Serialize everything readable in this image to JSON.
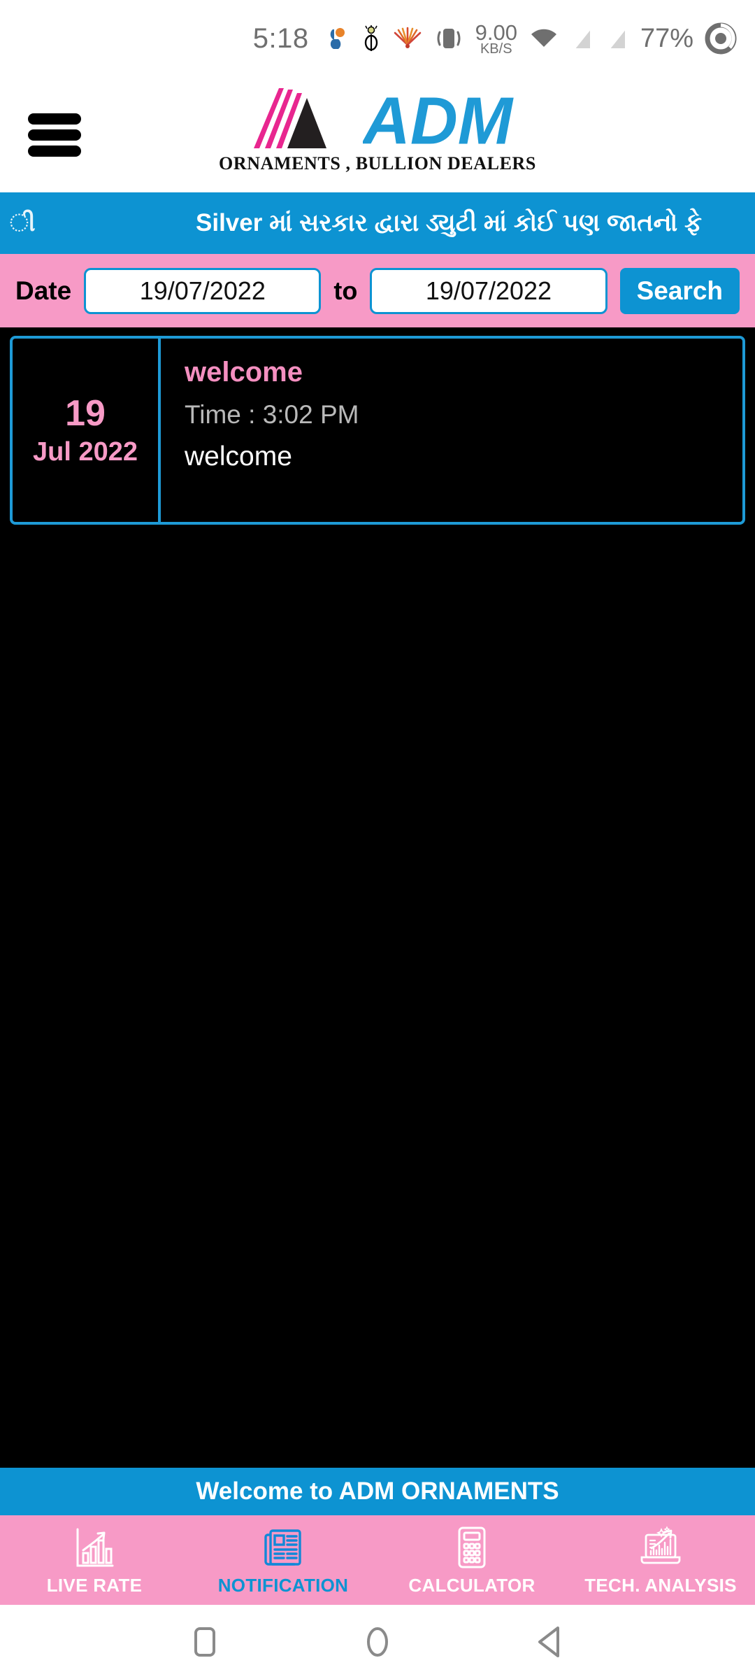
{
  "statusbar": {
    "time": "5:18",
    "icons": [
      "app-s-icon",
      "ornament-icon",
      "sunburst-icon",
      "vibrate-icon"
    ],
    "network_speed": "9.00",
    "network_unit": "KB/S",
    "wifi": "wifi-icon",
    "sim1": "sim-no-signal-icon",
    "sim2": "sim-no-signal-icon",
    "battery_percent": "77%",
    "battery_icon": "battery-circle-icon"
  },
  "header": {
    "menu_icon": "hamburger-menu-icon",
    "logo_mark": "adm-triangle-logo",
    "brand": "ADM",
    "tagline": "ORNAMENTS , BULLION DEALERS"
  },
  "ticker": {
    "lead_fragment": "ી",
    "text": "Silver માં સરકાર દ્વારા ડ્યુટી માં કોઈ પણ જાતનો ફે"
  },
  "search": {
    "date_label": "Date",
    "from_date": "19/07/2022",
    "to_label": "to",
    "to_date": "19/07/2022",
    "search_label": "Search"
  },
  "notifications": [
    {
      "day": "19",
      "month_year": "Jul 2022",
      "title": "welcome",
      "time_label": "Time :",
      "time_value": "3:02 PM",
      "message": "welcome"
    }
  ],
  "footer": {
    "welcome_text": "Welcome to ADM ORNAMENTS",
    "tabs": [
      {
        "label": "LIVE RATE",
        "icon": "bar-chart-growth-icon",
        "active": false
      },
      {
        "label": "NOTIFICATION",
        "icon": "newspaper-icon",
        "active": true
      },
      {
        "label": "CALCULATOR",
        "icon": "calculator-icon",
        "active": false
      },
      {
        "label": "TECH. ANALYSIS",
        "icon": "laptop-chart-icon",
        "active": false
      }
    ]
  },
  "navbar": {
    "recents": "square-recents-icon",
    "home": "circle-home-icon",
    "back": "triangle-back-icon"
  },
  "colors": {
    "brand_blue": "#0d93d2",
    "brand_pink": "#f79ac6",
    "logo_magenta": "#e8268f",
    "card_border": "#1e9ad6",
    "date_pink": "#f79ac6",
    "background": "#000000"
  }
}
